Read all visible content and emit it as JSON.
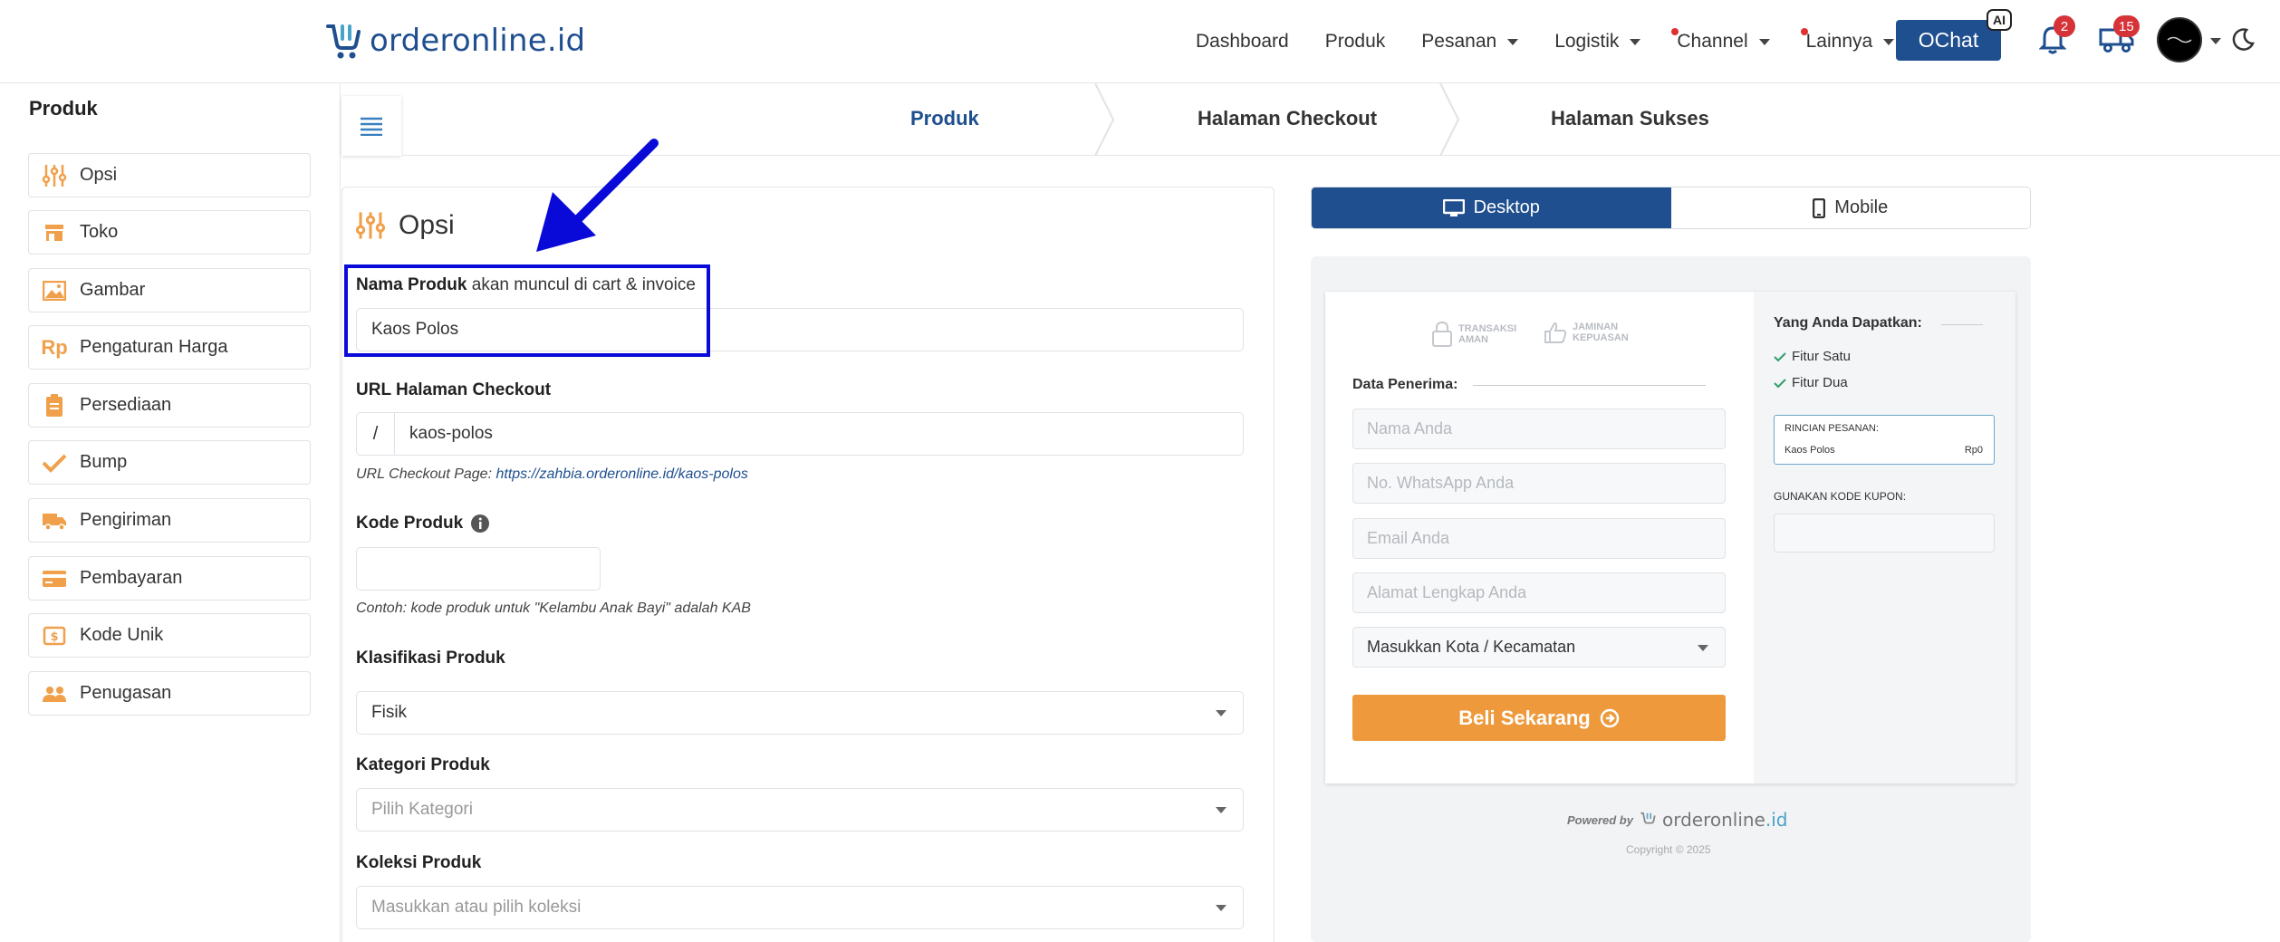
{
  "brand": {
    "name": "orderonline",
    "tld": ".id"
  },
  "nav": {
    "items": [
      {
        "label": "Dashboard",
        "dropdown": false,
        "dot": false
      },
      {
        "label": "Produk",
        "dropdown": false,
        "dot": false
      },
      {
        "label": "Pesanan",
        "dropdown": true,
        "dot": false
      },
      {
        "label": "Logistik",
        "dropdown": true,
        "dot": false
      },
      {
        "label": "Channel",
        "dropdown": true,
        "dot": true
      },
      {
        "label": "Lainnya",
        "dropdown": true,
        "dot": true
      }
    ],
    "ochat_label": "OChat",
    "ai_badge": "AI",
    "notif_count": "2",
    "delivery_count": "15"
  },
  "sidebar": {
    "title": "Produk",
    "items": [
      {
        "label": "Opsi",
        "icon": "sliders-icon"
      },
      {
        "label": "Toko",
        "icon": "store-icon"
      },
      {
        "label": "Gambar",
        "icon": "image-icon"
      },
      {
        "label": "Pengaturan Harga",
        "icon": "rp-icon"
      },
      {
        "label": "Persediaan",
        "icon": "clipboard-icon"
      },
      {
        "label": "Bump",
        "icon": "check-icon"
      },
      {
        "label": "Pengiriman",
        "icon": "truck-icon"
      },
      {
        "label": "Pembayaran",
        "icon": "card-icon"
      },
      {
        "label": "Kode Unik",
        "icon": "dollar-icon"
      },
      {
        "label": "Penugasan",
        "icon": "people-icon"
      }
    ]
  },
  "stepper": {
    "steps": [
      "Produk",
      "Halaman Checkout",
      "Halaman Sukses"
    ],
    "active": "Produk"
  },
  "form": {
    "section_title": "Opsi",
    "nama_produk": {
      "label": "Nama Produk",
      "sublabel": "akan muncul di cart & invoice",
      "value": "Kaos Polos"
    },
    "url": {
      "label": "URL Halaman Checkout",
      "prefix": "/",
      "value": "kaos-polos",
      "hint_prefix": "URL Checkout Page: ",
      "hint_link": "https://zahbia.orderonline.id/kaos-polos"
    },
    "kode": {
      "label": "Kode Produk",
      "value": "",
      "hint": "Contoh: kode produk untuk \"Kelambu Anak Bayi\" adalah KAB"
    },
    "klasifikasi": {
      "label": "Klasifikasi Produk",
      "value": "Fisik"
    },
    "kategori": {
      "label": "Kategori Produk",
      "placeholder": "Pilih Kategori"
    },
    "koleksi": {
      "label": "Koleksi Produk",
      "placeholder": "Masukkan atau pilih koleksi"
    }
  },
  "preview": {
    "toggle": {
      "desktop": "Desktop",
      "mobile": "Mobile",
      "selected": "Desktop"
    },
    "trust": {
      "t1a": "TRANSAKSI",
      "t1b": "AMAN",
      "t2a": "JAMINAN",
      "t2b": "KEPUASAN"
    },
    "data_penerima": "Data Penerima:",
    "fields": [
      "Nama Anda",
      "No. WhatsApp Anda",
      "Email Anda",
      "Alamat Lengkap Anda"
    ],
    "kota": "Masukkan Kota / Kecamatan",
    "buy_button": "Beli Sekarang",
    "yang_anda": "Yang Anda Dapatkan:",
    "features": [
      "Fitur Satu",
      "Fitur Dua"
    ],
    "rincian_title": "RINCIAN PESANAN:",
    "rincian_item": "Kaos Polos",
    "rincian_price": "Rp0",
    "kupon_label": "GUNAKAN KODE KUPON:",
    "powered_by": "Powered by",
    "powered_brand": "orderonline",
    "powered_tld": ".id",
    "copyright": "Copyright © 2025"
  },
  "colors": {
    "brand": "#1f4f8f",
    "accent": "#ee9a3c",
    "highlight": "#0a0ad8",
    "badge": "#d63339"
  }
}
